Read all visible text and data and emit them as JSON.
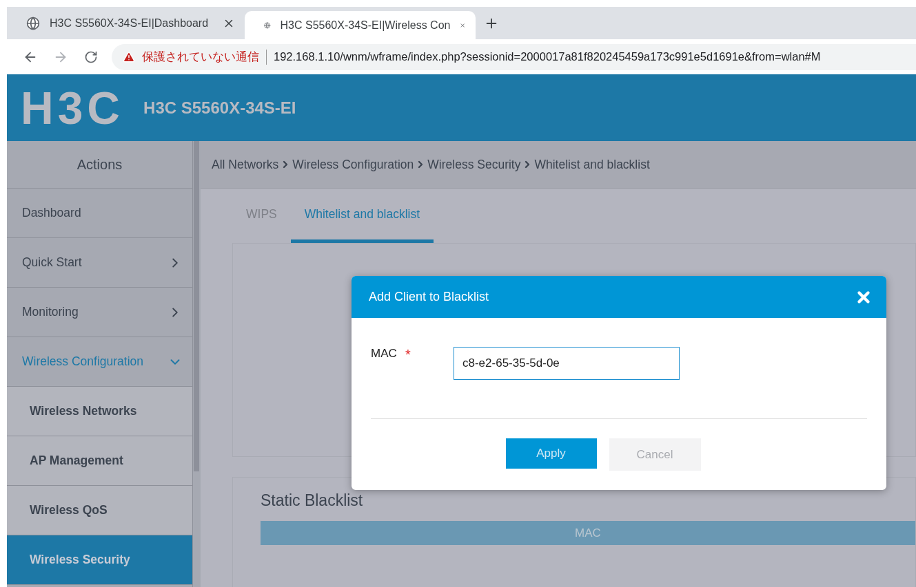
{
  "browser": {
    "tabs": [
      {
        "title": "H3C S5560X-34S-EI|Dashboard",
        "selected": false
      },
      {
        "title": "H3C S5560X-34S-EI|Wireless Con",
        "selected": true
      }
    ],
    "security_warning": "保護されていない通信",
    "url": "192.168.1.10/wnm/wframe/index.php?sessionid=2000017a81f820245459a173c991e5d1691e&from=wlan#M"
  },
  "header": {
    "logo": "H3C",
    "product": "H3C S5560X-34S-EI"
  },
  "sidebar": {
    "title": "Actions",
    "items": [
      {
        "label": "Dashboard",
        "selected": false
      },
      {
        "label": "Quick Start",
        "selected": false,
        "expanded": false
      },
      {
        "label": "Monitoring",
        "selected": false,
        "expanded": false
      },
      {
        "label": "Wireless Configuration",
        "selected": false,
        "expanded": true,
        "children": [
          {
            "label": "Wireless Networks",
            "selected": false
          },
          {
            "label": "AP Management",
            "selected": false
          },
          {
            "label": "Wireless QoS",
            "selected": false
          },
          {
            "label": "Wireless Security",
            "selected": true
          }
        ]
      }
    ]
  },
  "breadcrumb": [
    "All Networks",
    "Wireless Configuration",
    "Wireless Security",
    "Whitelist and blacklist"
  ],
  "tabs": [
    {
      "label": "WIPS",
      "selected": false
    },
    {
      "label": "Whitelist and blacklist",
      "selected": true
    }
  ],
  "static_blacklist": {
    "title": "Static Blacklist",
    "columns": [
      "MAC"
    ]
  },
  "dialog": {
    "title": "Add Client to Blacklist",
    "fields": [
      {
        "label": "MAC",
        "required_mark": "*",
        "value": "c8-e2-65-35-5d-0e"
      }
    ],
    "buttons": [
      {
        "label": "Apply",
        "kind": "primary"
      },
      {
        "label": "Cancel",
        "kind": "secondary"
      }
    ]
  }
}
